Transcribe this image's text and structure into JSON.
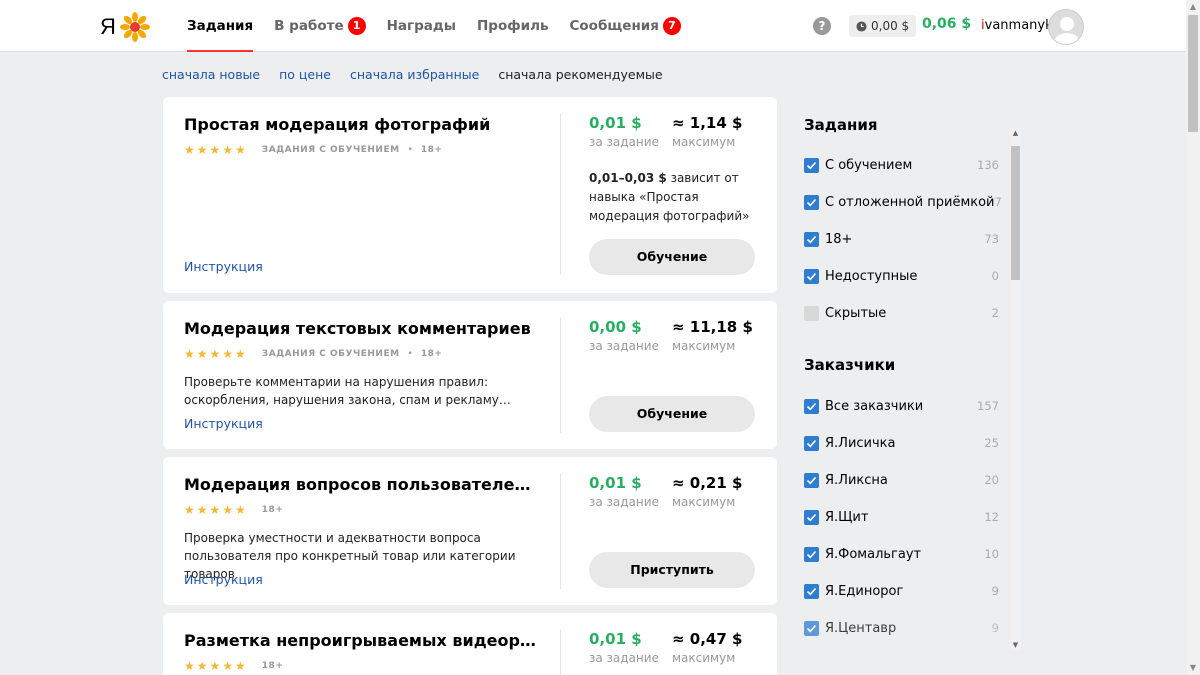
{
  "header": {
    "logo_text": "Я",
    "nav": [
      {
        "label": "Задания",
        "active": true,
        "badge": ""
      },
      {
        "label": "В работе",
        "active": false,
        "badge": "1"
      },
      {
        "label": "Награды",
        "active": false,
        "badge": ""
      },
      {
        "label": "Профиль",
        "active": false,
        "badge": ""
      },
      {
        "label": "Сообщения",
        "active": false,
        "badge": "7"
      }
    ],
    "help": "?",
    "pending_balance": "0,00 $",
    "balance": "0,06 $",
    "username": "ivanmanyk"
  },
  "sort": {
    "items": [
      "сначала новые",
      "по цене",
      "сначала избранные",
      "сначала рекомендуемые"
    ]
  },
  "cards": [
    {
      "title": "Простая модерация фотографий",
      "stars": "★★★★★",
      "tag": "Задания с обучением",
      "age": "18+",
      "description": "",
      "instruction": "Инструкция",
      "price": "0,01",
      "price_currency": "$",
      "price_label": "за задание",
      "max": "≈ 1,14",
      "max_currency": "$",
      "max_label": "максимум",
      "depends_range": "0,01–0,03 $",
      "depends_text": " зависит от навыка «Простая модерация фотографий»",
      "button": "Обучение"
    },
    {
      "title": "Модерация текстовых комментариев",
      "stars": "★★★★★",
      "tag": "Задания с обучением",
      "age": "18+",
      "description": "Проверьте комментарии на нарушения правил: оскорбления, нарушения закона, спам и рекламу…",
      "instruction": "Инструкция",
      "price": "0,00",
      "price_currency": "$",
      "price_label": "за задание",
      "max": "≈ 11,18",
      "max_currency": "$",
      "max_label": "максимум",
      "button": "Обучение"
    },
    {
      "title": "Модерация вопросов пользователей про то...",
      "stars": "★★★★★",
      "tag": "",
      "age": "18+",
      "description": "Проверка уместности и адекватности вопроса пользователя про конкретный товар или категории товаров",
      "instruction": "Инструкция",
      "price": "0,01",
      "price_currency": "$",
      "price_label": "за задание",
      "max": "≈ 0,21",
      "max_currency": "$",
      "max_label": "максимум",
      "button": "Приступить"
    },
    {
      "title": "Разметка непроигрываемых видеороликов ...",
      "stars": "★★★★★",
      "tag": "",
      "age": "18+",
      "price": "0,01",
      "price_currency": "$",
      "price_label": "за задание",
      "max": "≈ 0,47",
      "max_currency": "$",
      "max_label": "максимум"
    }
  ],
  "filters": {
    "tasks_title": "Задания",
    "tasks": [
      {
        "label": "С обучением",
        "count": "136",
        "checked": true
      },
      {
        "label": "С отложенной приёмкой",
        "count": "7",
        "checked": true
      },
      {
        "label": "18+",
        "count": "73",
        "checked": true
      },
      {
        "label": "Недоступные",
        "count": "0",
        "checked": true
      },
      {
        "label": "Скрытые",
        "count": "2",
        "checked": false
      }
    ],
    "clients_title": "Заказчики",
    "clients": [
      {
        "label": "Все заказчики",
        "count": "157",
        "checked": true
      },
      {
        "label": "Я.Лисичка",
        "count": "25",
        "checked": true
      },
      {
        "label": "Я.Ликсна",
        "count": "20",
        "checked": true
      },
      {
        "label": "Я.Щит",
        "count": "12",
        "checked": true
      },
      {
        "label": "Я.Фомальгаут",
        "count": "10",
        "checked": true
      },
      {
        "label": "Я.Единорог",
        "count": "9",
        "checked": true
      },
      {
        "label": "Я.Центавр",
        "count": "9",
        "checked": true
      }
    ]
  },
  "colors": {
    "accent_green": "#27ae60",
    "link_blue": "#1f55a6",
    "badge_red": "#ff0000",
    "checkbox_blue": "#2f7dd1",
    "star_yellow": "#f2b937"
  }
}
